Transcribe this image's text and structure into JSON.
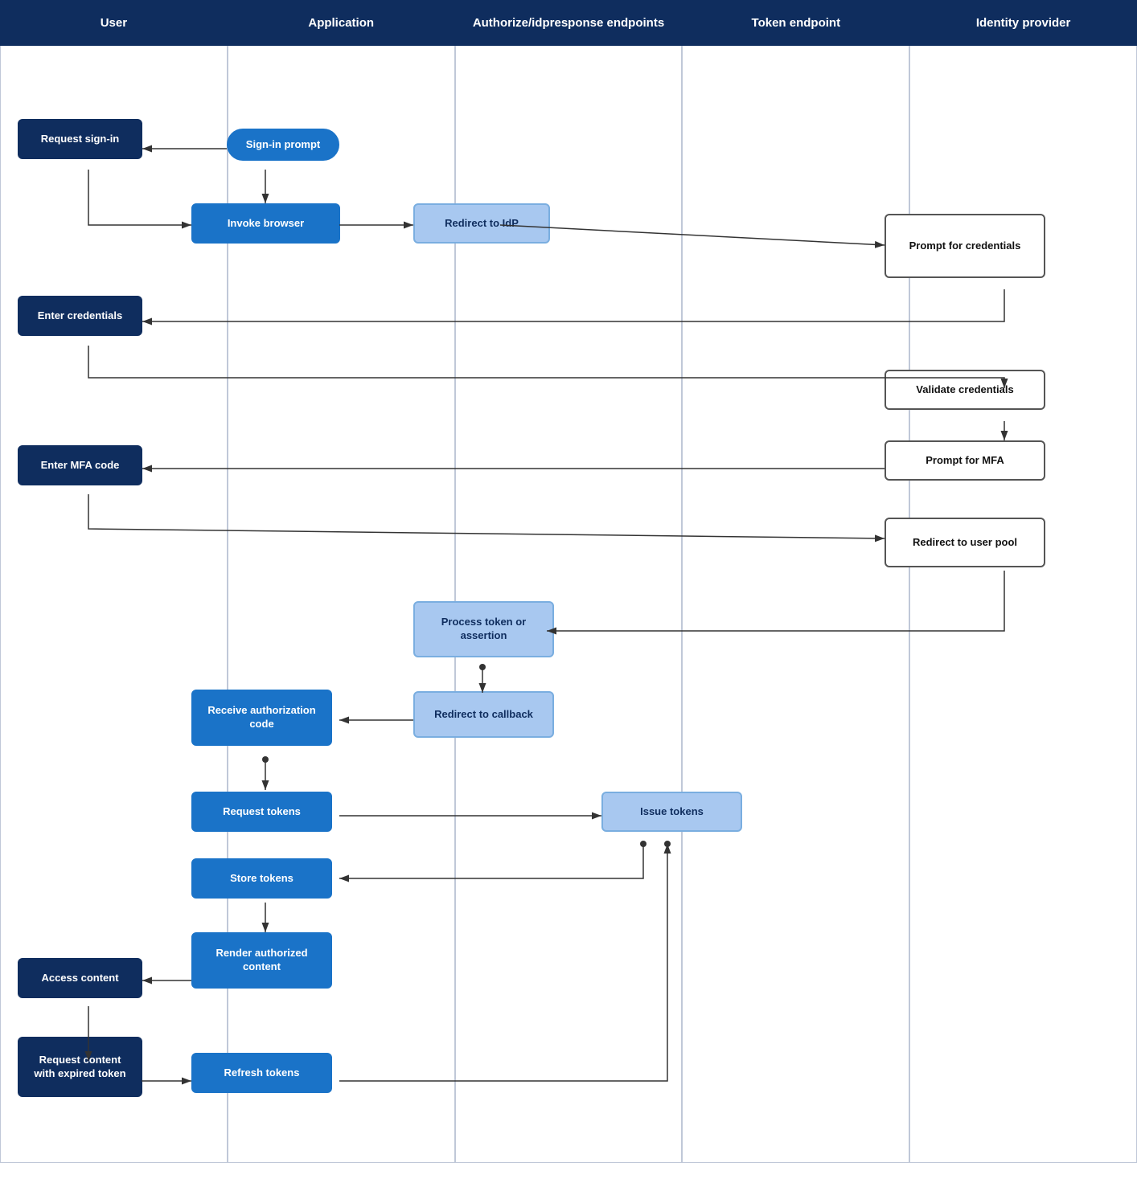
{
  "headers": [
    {
      "label": "User"
    },
    {
      "label": "Application"
    },
    {
      "label": "Authorize/idpresponse endpoints"
    },
    {
      "label": "Token endpoint"
    },
    {
      "label": "Identity provider"
    }
  ],
  "nodes": {
    "request_signin": "Request sign-in",
    "signin_prompt": "Sign-in prompt",
    "invoke_browser": "Invoke browser",
    "redirect_idp": "Redirect to IdP",
    "prompt_credentials": "Prompt for credentials",
    "enter_credentials": "Enter credentials",
    "validate_credentials": "Validate credentials",
    "prompt_mfa": "Prompt for MFA",
    "enter_mfa": "Enter MFA code",
    "redirect_user_pool": "Redirect to user pool",
    "process_token": "Process token or assertion",
    "redirect_callback": "Redirect to callback",
    "receive_auth_code": "Receive authorization code",
    "request_tokens": "Request tokens",
    "issue_tokens": "Issue tokens",
    "store_tokens": "Store tokens",
    "access_content": "Access content",
    "render_authorized": "Render authorized content",
    "request_expired": "Request content with expired token",
    "refresh_tokens": "Refresh tokens"
  }
}
